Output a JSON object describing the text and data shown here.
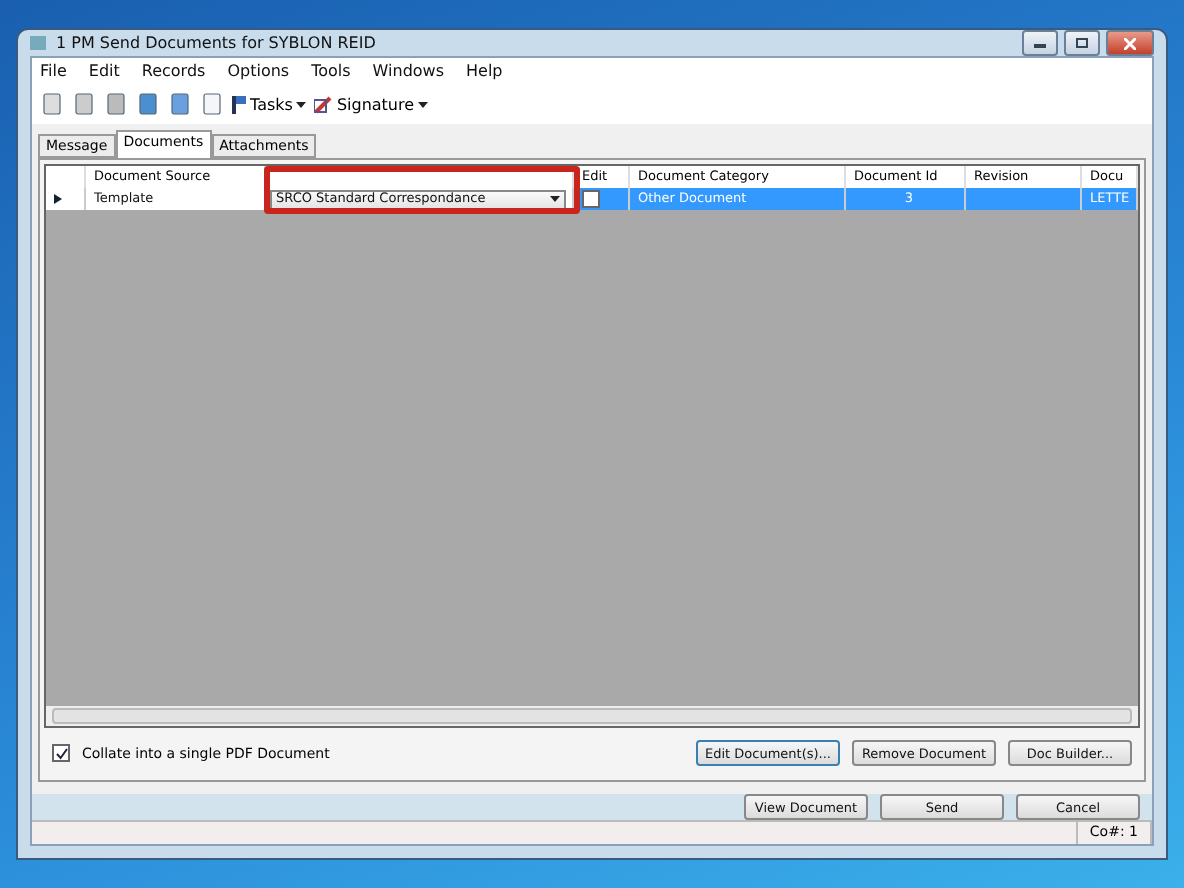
{
  "window": {
    "title": "1 PM Send Documents for SYBLON REID"
  },
  "menu": [
    "File",
    "Edit",
    "Records",
    "Options",
    "Tools",
    "Windows",
    "Help"
  ],
  "toolbar": {
    "tasks": "Tasks",
    "signature": "Signature"
  },
  "tabs": [
    {
      "label": "Message",
      "selected": false
    },
    {
      "label": "Documents",
      "selected": true
    },
    {
      "label": "Attachments",
      "selected": false
    }
  ],
  "table": {
    "columns": [
      "Document Source",
      "",
      "Edit",
      "Document Category",
      "Document Id",
      "Revision",
      "Docu"
    ],
    "rows": [
      {
        "selected": true,
        "source": "Template",
        "document": "SRCO Standard Correspondance",
        "edit_checked": false,
        "category": "Other Document",
        "document_id": "3",
        "revision": "",
        "column_7": "LETTE"
      }
    ]
  },
  "collate": {
    "label": "Collate into a single PDF Document",
    "checked": true
  },
  "panel_buttons": [
    "Edit Document(s)...",
    "Remove Document",
    "Doc Builder..."
  ],
  "dialog_buttons": [
    "View Document",
    "Send",
    "Cancel"
  ],
  "status_bar": "Co#: 1"
}
